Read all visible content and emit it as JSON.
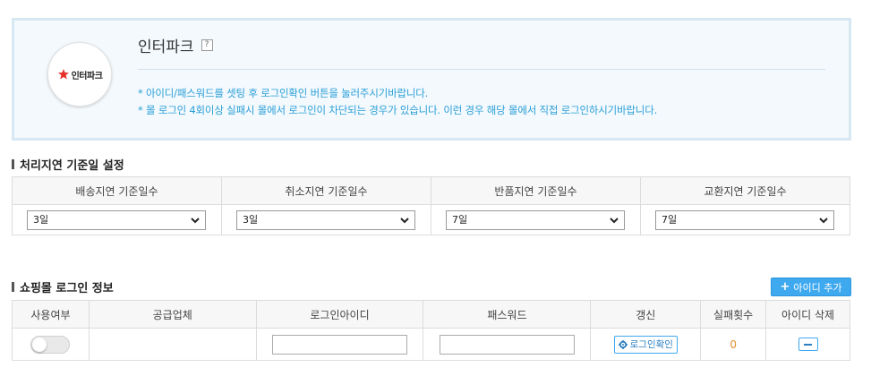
{
  "mall": {
    "logo_text": "인터파크",
    "title": "인터파크",
    "help_icon": "?",
    "notices": [
      "* 아이디/패스워드를 셋팅 후 로그인확인 버튼을 눌러주시기바랍니다.",
      "* 몰 로그인 4회이상 실패시 몰에서 로그인이 차단되는 경우가 있습니다. 이런 경우 해당 몰에서 직접 로그인하시기바랍니다."
    ]
  },
  "delay_section": {
    "title": "처리지연 기준일 설정",
    "columns": [
      "배송지연 기준일수",
      "취소지연 기준일수",
      "반품지연 기준일수",
      "교환지연 기준일수"
    ],
    "values": [
      "3일",
      "3일",
      "7일",
      "7일"
    ]
  },
  "login_section": {
    "title": "쇼핑몰 로그인 정보",
    "add_button": "아이디 추가",
    "columns": [
      "사용여부",
      "공급업체",
      "로그인아이디",
      "패스워드",
      "갱신",
      "실패횟수",
      "아이디 삭제"
    ],
    "row": {
      "use_enabled": false,
      "supplier": "",
      "login_id": "",
      "password": "",
      "renew_button": "로그인확인",
      "fail_count": "0"
    }
  },
  "colors": {
    "accent": "#3fa9f0",
    "notice": "#2b9fd7",
    "info_bg": "#f3f9fd",
    "fail": "#e0902a"
  }
}
